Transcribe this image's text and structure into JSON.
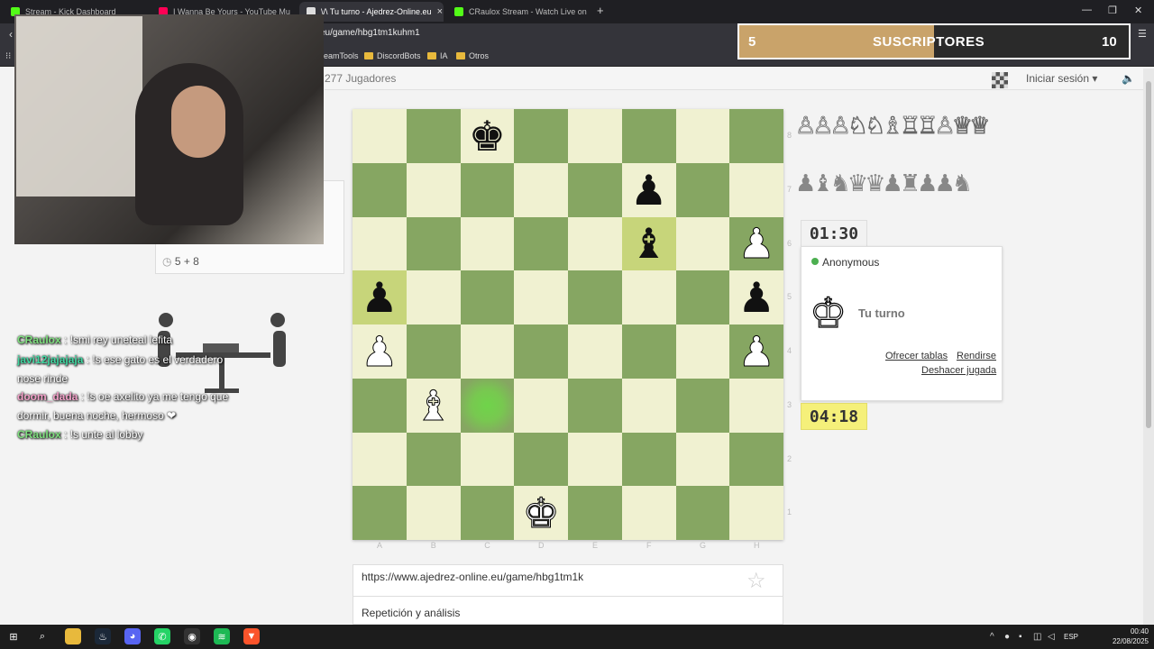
{
  "browser": {
    "tabs": [
      {
        "title": "Stream - Kick Dashboard",
        "color": "#53fc18"
      },
      {
        "title": "I Wanna Be Yours - YouTube Mu",
        "color": "#ff0055"
      },
      {
        "title": "\\/\\ Tu turno - Ajedrez-Online.eu",
        "color": "#dddddd",
        "active": true
      },
      {
        "title": "CRaulox Stream - Watch Live on",
        "color": "#53fc18"
      }
    ],
    "close_symbol": "×",
    "new_tab_symbol": "+",
    "url": "eu/game/hbg1tm1kuhm1",
    "bookmarks": [
      "reamTools",
      "DiscordBots",
      "IA",
      "Otros"
    ]
  },
  "overlay": {
    "subs_current": "5",
    "subs_label": "SUSCRIPTORES",
    "subs_goal": "10",
    "progress_fraction": 0.5
  },
  "site": {
    "players": "277 Jugadores",
    "login": "Iniciar sesión ▾",
    "sound_icon": "🔈"
  },
  "game": {
    "time_control": "5 + 8",
    "clock_top": "01:30",
    "clock_bottom": "04:18",
    "opponent": "Anonymous",
    "turn_label": "Tu turno",
    "turn_king": "♔",
    "offer_draw": "Ofrecer tablas",
    "resign": "Rendirse",
    "undo": "Deshacer jugada",
    "captured_top": "♙♙♙♘♘♗♖♖♙♕♕",
    "captured_bottom": "♟♝♞♛♛♟♜♟♟♞",
    "ranks": [
      "8",
      "7",
      "6",
      "5",
      "4",
      "3",
      "2",
      "1"
    ],
    "files": [
      "A",
      "B",
      "C",
      "D",
      "E",
      "F",
      "G",
      "H"
    ],
    "board": [
      [
        "",
        "",
        "bk",
        "",
        "",
        "",
        "",
        ""
      ],
      [
        "",
        "",
        "",
        "",
        "",
        "bp",
        "",
        ""
      ],
      [
        "",
        "",
        "",
        "",
        "",
        "bb",
        "",
        "wp"
      ],
      [
        "bp",
        "",
        "",
        "",
        "",
        "",
        "",
        "bp"
      ],
      [
        "wp",
        "",
        "",
        "",
        "",
        "",
        "",
        "wp"
      ],
      [
        "",
        "wb",
        "",
        "",
        "",
        "",
        "",
        ""
      ],
      [
        "",
        "",
        "",
        "",
        "",
        "",
        "",
        ""
      ],
      [
        "",
        "",
        "",
        "wk",
        "",
        "",
        "",
        ""
      ]
    ],
    "highlight_squares": [
      "a5",
      "f6"
    ],
    "move_target": "c3",
    "share_url": "https://www.ajedrez-online.eu/game/hbg1tm1k",
    "analysis": "Repetición y análisis",
    "star_icon": "☆"
  },
  "chat": [
    {
      "user": "CRaulox",
      "color": "#7fe07f",
      "text": " : !smi rey uneteal lefita"
    },
    {
      "user": "javi12jajajaja",
      "color": "#3fd6a0",
      "text": " : !s ese gato es el verdadero nose rinde"
    },
    {
      "user": "doom_dada",
      "color": "#f2a0c8",
      "text": " : !s oe axelito ya me tengo que dormir, buena noche, hermoso ❤"
    },
    {
      "user": "CRaulox",
      "color": "#7fe07f",
      "text": " : !s unte al lobby"
    }
  ],
  "taskbar": {
    "lang": "ESP",
    "time": "00:40",
    "date": "22/08/2025"
  }
}
